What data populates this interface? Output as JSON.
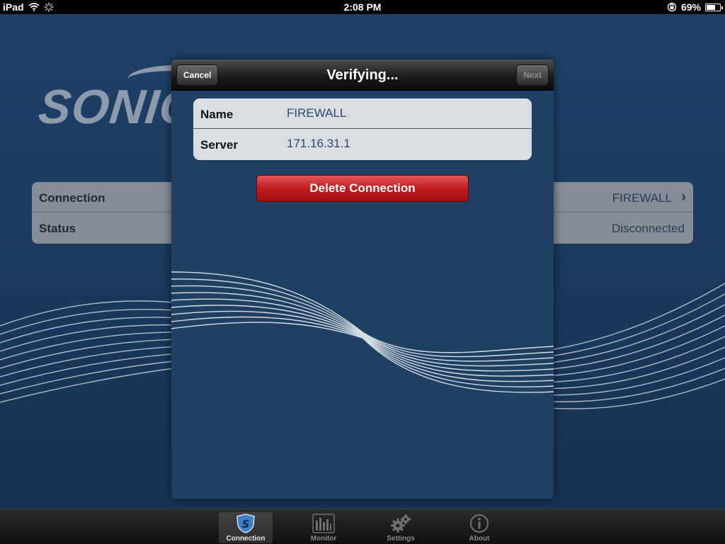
{
  "status_bar": {
    "device": "iPad",
    "time": "2:08 PM",
    "battery": "69%",
    "battery_level": 0.69
  },
  "background": {
    "logo_text": "SONICV",
    "rows": [
      {
        "label": "Connection",
        "value": "FIREWALL"
      },
      {
        "label": "Status",
        "value": "Disconnected"
      }
    ]
  },
  "modal": {
    "title": "Verifying...",
    "cancel_label": "Cancel",
    "next_label": "Next",
    "fields": [
      {
        "label": "Name",
        "value": "FIREWALL"
      },
      {
        "label": "Server",
        "value": "171.16.31.1"
      }
    ],
    "delete_label": "Delete Connection"
  },
  "tab_bar": {
    "tabs": [
      {
        "label": "Connection",
        "icon": "shield-icon",
        "active": true
      },
      {
        "label": "Monitor",
        "icon": "bar-chart-icon",
        "active": false
      },
      {
        "label": "Settings",
        "icon": "gear-icon",
        "active": false
      },
      {
        "label": "About",
        "icon": "info-icon",
        "active": false
      }
    ]
  },
  "colors": {
    "background": "#1b3a5f",
    "modal_background": "#1f3f63",
    "delete_red": "#c01d1d",
    "value_blue": "#2c4a73"
  }
}
